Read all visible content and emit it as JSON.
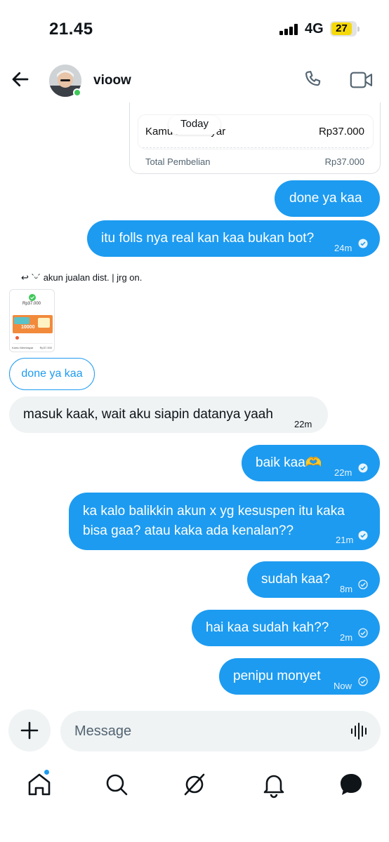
{
  "status_bar": {
    "time": "21.45",
    "network": "4G",
    "battery": "27"
  },
  "header": {
    "contact_name": "vioow"
  },
  "receipt_card": {
    "paid_label": "Kamu membayar",
    "paid_value": "Rp37.000",
    "total_label": "Total Pembelian",
    "total_value": "Rp37.000"
  },
  "date_chip": "Today",
  "messages": {
    "m1": {
      "text": "done ya kaa"
    },
    "m2": {
      "text": "itu folls nya real kan kaa bukan bot?",
      "time": "24m"
    },
    "reply_header": "`ᵕ´ akun jualan dist. | jrg on.",
    "thumb": {
      "amount": "Rp37.000",
      "promo": "10000",
      "footer_left": "Kamu Membayar",
      "footer_right": "Rp37.000"
    },
    "quoted": "done ya kaa",
    "m3": {
      "text": "masuk kaak, wait aku siapin datanya yaah",
      "time": "22m"
    },
    "m4": {
      "text": "baik kaa🫶",
      "time": "22m"
    },
    "m5": {
      "line1": "ka kalo balikkin akun x yg kesuspen itu kaka",
      "line2": "bisa gaa? atau kaka ada kenalan??",
      "time": "21m"
    },
    "m6": {
      "text": "sudah kaa?",
      "time": "8m"
    },
    "m7": {
      "text": "hai kaa sudah kah??",
      "time": "2m"
    },
    "m8": {
      "text": "penipu monyet",
      "time": "Now"
    }
  },
  "composer": {
    "placeholder": "Message"
  },
  "nav": {
    "items": [
      "home-icon",
      "search-icon",
      "grok-icon",
      "notifications-icon",
      "messages-icon"
    ]
  },
  "colors": {
    "accent": "#1d9bf0",
    "received_bubble": "#eff3f4",
    "text": "#0f1419",
    "muted": "#536471"
  }
}
